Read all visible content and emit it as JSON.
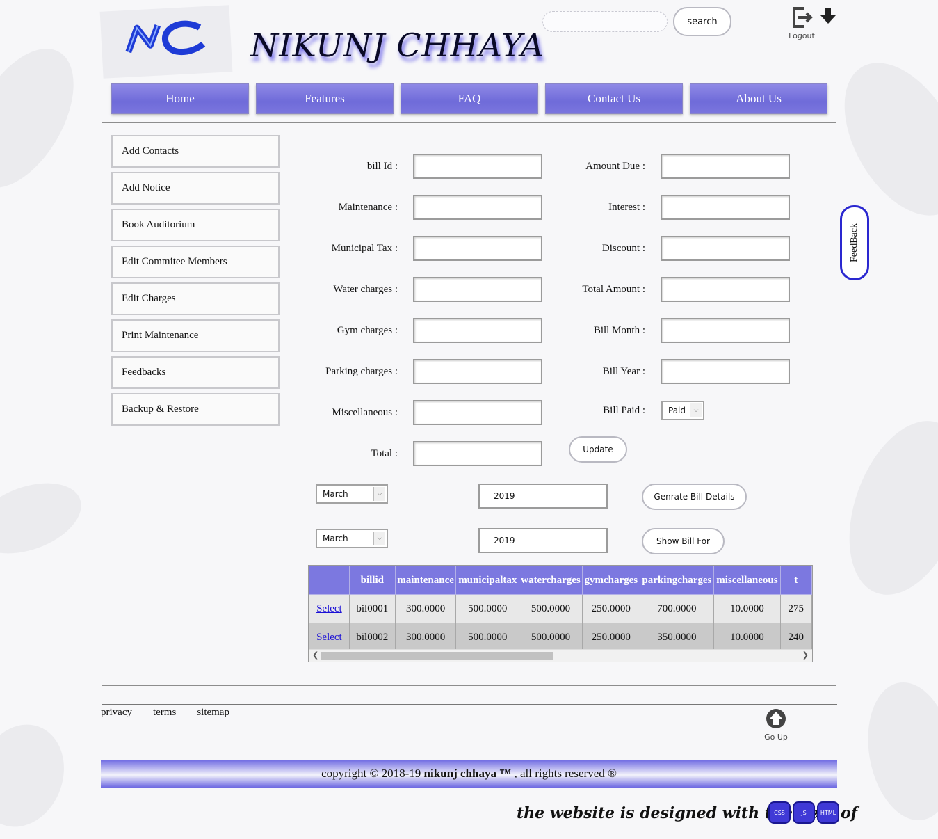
{
  "header": {
    "site_title": "NIKUNJ CHHAYA",
    "search_placeholder": "",
    "search_label": "search",
    "logout_label": "Logout"
  },
  "nav": [
    "Home",
    "Features",
    "FAQ",
    "Contact Us",
    "About Us"
  ],
  "sidebar": [
    "Add Contacts",
    "Add Notice",
    "Book Auditorium",
    "Edit Commitee Members",
    "Edit Charges",
    "Print Maintenance",
    "Feedbacks",
    "Backup & Restore"
  ],
  "form": {
    "left": [
      "bill Id :",
      "Maintenance :",
      "Municipal Tax :",
      "Water charges :",
      "Gym charges :",
      "Parking charges :",
      "Miscellaneous :",
      "Total :"
    ],
    "right": [
      "Amount Due :",
      "Interest :",
      "Discount :",
      "Total Amount :",
      "Bill Month :",
      "Bill Year :",
      "Bill Paid :"
    ],
    "bill_paid_value": "Paid",
    "update_label": "Update"
  },
  "generate": {
    "month": "March",
    "year": "2019",
    "button": "Genrate Bill Details"
  },
  "show": {
    "month": "March",
    "year": "2019",
    "button": "Show Bill For"
  },
  "grid": {
    "headers": [
      "",
      "billid",
      "maintenance",
      "municipaltax",
      "watercharges",
      "gymcharges",
      "parkingcharges",
      "miscellaneous",
      "t"
    ],
    "rows": [
      [
        "Select",
        "bil0001",
        "300.0000",
        "500.0000",
        "500.0000",
        "250.0000",
        "700.0000",
        "10.0000",
        "275"
      ],
      [
        "Select",
        "bil0002",
        "300.0000",
        "500.0000",
        "500.0000",
        "250.0000",
        "350.0000",
        "10.0000",
        "240"
      ]
    ]
  },
  "feedback_tab": "FeedBack",
  "footer": {
    "links": [
      "privacy",
      "terms",
      "sitemap"
    ],
    "goup_label": "Go Up",
    "copyright_prefix": "copyright © 2018-19",
    "copyright_brand": "nikunj chhaya ™",
    "copyright_suffix": ", all rights reserved ®",
    "credits": "the website is designed with the help of",
    "badges": [
      "CSS",
      "JS",
      "HTML"
    ]
  },
  "colors": {
    "accent": "#7c78e0",
    "feedback_border": "#2a27d0",
    "badge": "#3f39d6"
  }
}
